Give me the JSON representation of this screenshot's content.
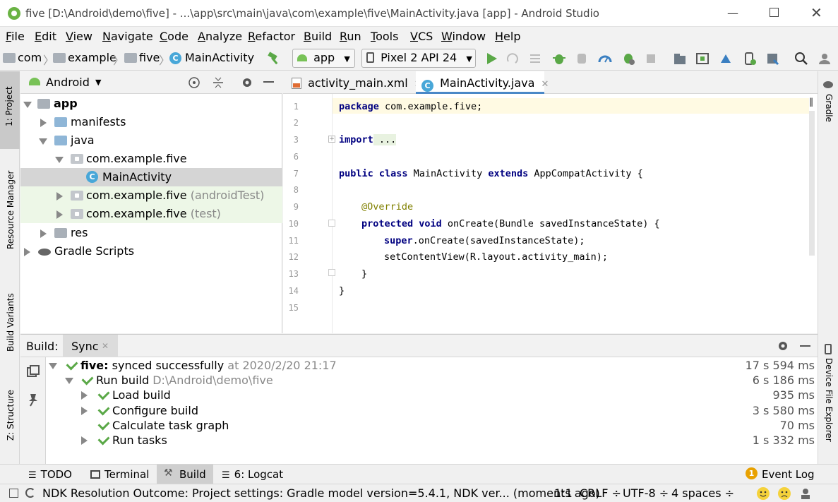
{
  "window": {
    "title": "five [D:\\Android\\demo\\five] - ...\\app\\src\\main\\java\\com\\example\\five\\MainActivity.java [app] - Android Studio"
  },
  "menu": [
    "File",
    "Edit",
    "View",
    "Navigate",
    "Code",
    "Analyze",
    "Refactor",
    "Build",
    "Run",
    "Tools",
    "VCS",
    "Window",
    "Help"
  ],
  "breadcrumb": [
    "com",
    "example",
    "five",
    "MainActivity"
  ],
  "toolbar": {
    "run_config": "app",
    "device": "Pixel 2 API 24"
  },
  "left_strip": {
    "project": "1: Project",
    "resource_manager": "Resource Manager",
    "build_variants": "Build Variants",
    "structure": "Z: Structure"
  },
  "right_strip": {
    "gradle": "Gradle",
    "device_file_explorer": "Device File Explorer"
  },
  "project": {
    "view": "Android",
    "tree": [
      {
        "label": "app",
        "bold": true
      },
      {
        "label": "manifests"
      },
      {
        "label": "java"
      },
      {
        "label": "com.example.five"
      },
      {
        "label": "MainActivity"
      },
      {
        "label": "com.example.five",
        "suffix": "(androidTest)"
      },
      {
        "label": "com.example.five",
        "suffix": "(test)"
      },
      {
        "label": "res"
      },
      {
        "label": "Gradle Scripts"
      }
    ]
  },
  "editor": {
    "tabs": [
      "activity_main.xml",
      "MainActivity.java"
    ],
    "line_numbers": [
      "1",
      "2",
      "3",
      "6",
      "7",
      "8",
      "9",
      "10",
      "11",
      "12",
      "13",
      "14",
      "15"
    ],
    "code": {
      "l1_kw": "package",
      "l1_rest": " com.example.five;",
      "l3_kw": "import",
      "l3_rest": " ...",
      "l7_kw1": "public class",
      "l7_mid": " MainActivity ",
      "l7_kw2": "extends",
      "l7_rest": " AppCompatActivity {",
      "l9": "@Override",
      "l10_kw": "protected void",
      "l10_rest": " onCreate(Bundle savedInstanceState) {",
      "l11_kw": "super",
      "l11_rest": ".onCreate(savedInstanceState);",
      "l12": "setContentView(R.layout.activity_main);",
      "l13": "}",
      "l14": "}"
    }
  },
  "build": {
    "label": "Build:",
    "tab": "Sync",
    "rows": [
      {
        "bold": "five:",
        "text": " synced successfully",
        "gray": " at 2020/2/20 21:17",
        "time": "17 s 594 ms"
      },
      {
        "text": "Run build",
        "gray": " D:\\Android\\demo\\five",
        "time": "6 s 186 ms"
      },
      {
        "text": "Load build",
        "time": "935 ms"
      },
      {
        "text": "Configure build",
        "time": "3 s 580 ms"
      },
      {
        "text": "Calculate task graph",
        "time": "70 ms"
      },
      {
        "text": "Run tasks",
        "time": "1 s 332 ms"
      }
    ]
  },
  "bottom_tabs": {
    "todo": "TODO",
    "terminal": "Terminal",
    "build": "Build",
    "logcat": "6: Logcat",
    "event_log": "Event Log",
    "event_count": "1"
  },
  "status": {
    "message": "NDK Resolution Outcome: Project settings: Gradle model version=5.4.1, NDK ver... (moments ago)",
    "position": "1:1",
    "line_sep": "CRLF ÷",
    "encoding": "UTF-8 ÷",
    "indent": "4 spaces ÷"
  },
  "colors": {
    "check_green": "#5aa847",
    "android_green": "#78c257",
    "keyword": "#000080",
    "annotation": "#808000",
    "selection": "#d5d5d5",
    "test_bg": "#edf7e7",
    "line_highlight": "#fffae3"
  }
}
